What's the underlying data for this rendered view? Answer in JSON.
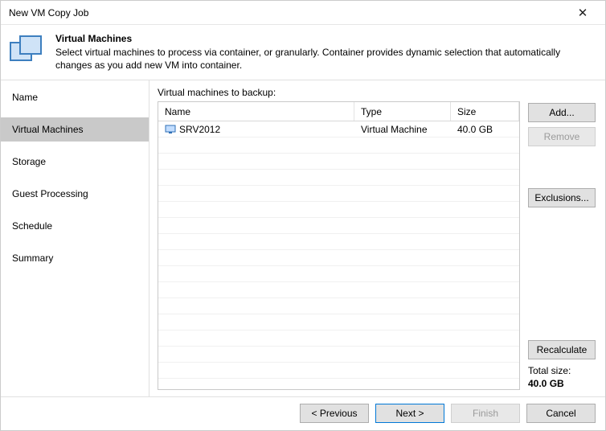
{
  "window": {
    "title": "New VM Copy Job"
  },
  "header": {
    "title": "Virtual Machines",
    "description": "Select virtual machines to process via container, or granularly. Container provides dynamic selection that automatically changes as you add new VM into container."
  },
  "sidebar": {
    "items": [
      {
        "label": "Name",
        "selected": false
      },
      {
        "label": "Virtual Machines",
        "selected": true
      },
      {
        "label": "Storage",
        "selected": false
      },
      {
        "label": "Guest Processing",
        "selected": false
      },
      {
        "label": "Schedule",
        "selected": false
      },
      {
        "label": "Summary",
        "selected": false
      }
    ]
  },
  "main": {
    "caption": "Virtual machines to backup:",
    "columns": {
      "name": "Name",
      "type": "Type",
      "size": "Size"
    },
    "rows": [
      {
        "name": "SRV2012",
        "type": "Virtual Machine",
        "size": "40.0 GB"
      }
    ]
  },
  "buttons": {
    "add": "Add...",
    "remove": "Remove",
    "exclusions": "Exclusions...",
    "recalculate": "Recalculate"
  },
  "total": {
    "label": "Total size:",
    "value": "40.0 GB"
  },
  "footer": {
    "previous": "< Previous",
    "next": "Next >",
    "finish": "Finish",
    "cancel": "Cancel"
  }
}
